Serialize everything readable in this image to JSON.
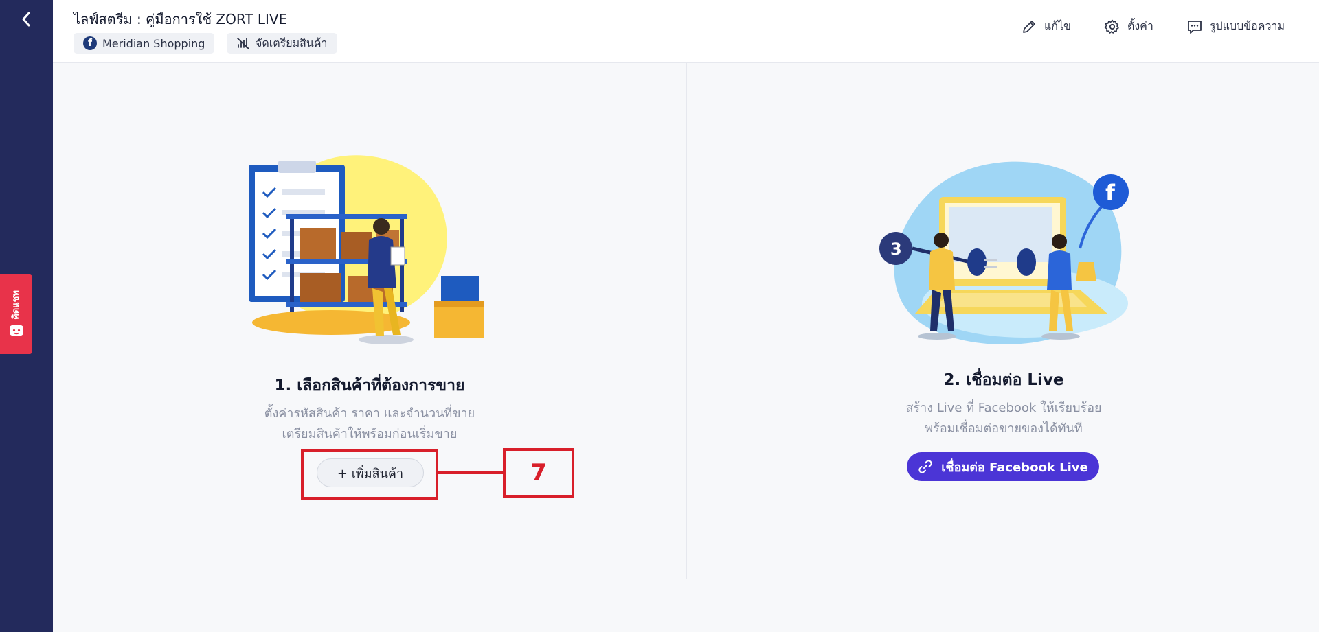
{
  "header": {
    "title": "ไลฟ์สตรีม : คู่มือการใช้ ZORT LIVE",
    "tags": [
      {
        "label": "Meridian Shopping",
        "icon": "facebook-icon"
      },
      {
        "label": "จัดเตรียมสินค้า",
        "icon": "no-signal-icon"
      }
    ],
    "actions": [
      {
        "label": "แก้ไข",
        "icon": "pencil-icon"
      },
      {
        "label": "ตั้งค่า",
        "icon": "gear-icon"
      },
      {
        "label": "รูปแบบข้อความ",
        "icon": "message-icon"
      }
    ]
  },
  "sidebar": {
    "back_icon": "chevron-left-icon",
    "chat_tab_label": "คิดแชท"
  },
  "step1": {
    "title": "1. เลือกสินค้าที่ต้องการขาย",
    "desc_line1": "ตั้งค่ารหัสสินค้า ราคา และจำนวนที่ขาย",
    "desc_line2": "เตรียมสินค้าให้พร้อมก่อนเริ่มขาย",
    "button_label": "+ เพิ่มสินค้า"
  },
  "annotation": {
    "number": "7",
    "color": "#d81f2a"
  },
  "step2": {
    "title": "2. เชื่อมต่อ Live",
    "desc_line1": "สร้าง Live ที่ Facebook ให้เรียบร้อย",
    "desc_line2": "พร้อมเชื่อมต่อขายของได้ทันที",
    "button_label": "เชื่อมต่อ Facebook Live"
  },
  "colors": {
    "sidebar": "#232a5c",
    "accent": "#4b35d6",
    "chat_tab": "#e8334a"
  }
}
